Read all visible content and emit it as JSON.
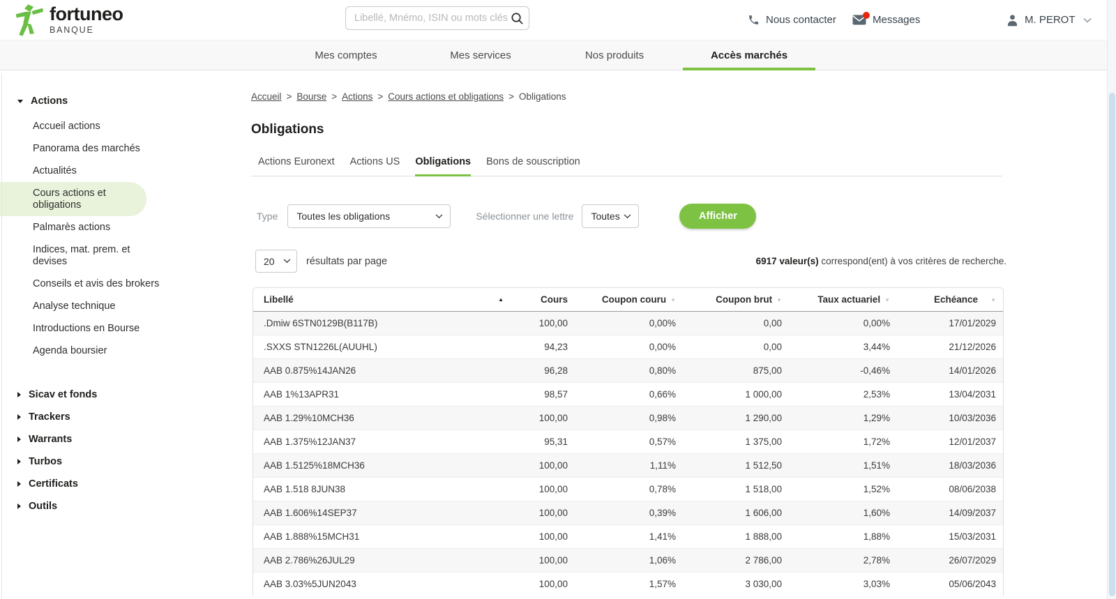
{
  "colors": {
    "accent_green": "#7dc242",
    "active_item_bg": "#e9f3dc",
    "notification_red": "#e8250c"
  },
  "icons": {
    "search": "magnifier-icon",
    "contact": "phone-icon",
    "messages": "envelope-icon",
    "messages_badge": "notification-dot",
    "user": "person-icon",
    "user_menu": "chevron-down-icon",
    "sort_active": "sort-asc-triangle",
    "sort_inactive": "sort-desc-triangle",
    "section_expanded": "triangle-down-icon",
    "section_collapsed": "triangle-right-icon"
  },
  "header": {
    "logo": {
      "brand": "fortuneo",
      "sub": "BANQUE"
    },
    "search": {
      "placeholder": "Libellé, Mnémo, ISIN ou mots clés"
    },
    "contact_label": "Nous contacter",
    "messages_label": "Messages",
    "user_name": "M. PEROT"
  },
  "nav": {
    "items": [
      {
        "label": "Mes comptes",
        "active": false
      },
      {
        "label": "Mes services",
        "active": false
      },
      {
        "label": "Nos produits",
        "active": false
      },
      {
        "label": "Accès marchés",
        "active": true
      }
    ]
  },
  "sidebar": {
    "sections": [
      {
        "label": "Actions",
        "expanded": true,
        "active_index": 3,
        "items": [
          "Accueil actions",
          "Panorama des marchés",
          "Actualités",
          "Cours actions et obligations",
          "Palmarès actions",
          "Indices, mat. prem. et devises",
          "Conseils et avis des brokers",
          "Analyse technique",
          "Introductions en Bourse",
          "Agenda boursier"
        ]
      },
      {
        "label": "Sicav et fonds",
        "expanded": false
      },
      {
        "label": "Trackers",
        "expanded": false
      },
      {
        "label": "Warrants",
        "expanded": false
      },
      {
        "label": "Turbos",
        "expanded": false
      },
      {
        "label": "Certificats",
        "expanded": false
      },
      {
        "label": "Outils",
        "expanded": false
      }
    ]
  },
  "breadcrumb": {
    "links": [
      "Accueil",
      "Bourse",
      "Actions",
      "Cours actions et obligations"
    ],
    "current": "Obligations",
    "separator": ">"
  },
  "page": {
    "title": "Obligations"
  },
  "tabs": {
    "items": [
      {
        "label": "Actions Euronext",
        "active": false
      },
      {
        "label": "Actions US",
        "active": false
      },
      {
        "label": "Obligations",
        "active": true
      },
      {
        "label": "Bons de souscription",
        "active": false
      }
    ]
  },
  "filters": {
    "type_label": "Type",
    "type_value": "Toutes les obligations",
    "letter_label": "Sélectionner une lettre",
    "letter_value": "Toutes",
    "submit_label": "Afficher"
  },
  "results": {
    "per_page_value": "20",
    "per_page_label": "résultats par page",
    "count_bold": "6917 valeur(s)",
    "count_rest": " correspond(ent) à vos critères de recherche."
  },
  "table": {
    "columns": [
      {
        "label": "Libellé",
        "sort": "asc"
      },
      {
        "label": "Cours",
        "sort": "none"
      },
      {
        "label": "Coupon couru",
        "sort": "inactive"
      },
      {
        "label": "Coupon brut",
        "sort": "inactive"
      },
      {
        "label": "Taux actuariel",
        "sort": "inactive"
      },
      {
        "label": "Echéance",
        "sort": "inactive"
      }
    ],
    "rows": [
      [
        ".Dmiw 6STN0129B(B117B)",
        "100,00",
        "0,00%",
        "0,00",
        "0,00%",
        "17/01/2029"
      ],
      [
        ".SXXS STN1226L(AUUHL)",
        "94,23",
        "0,00%",
        "0,00",
        "3,44%",
        "21/12/2026"
      ],
      [
        "AAB 0.875%14JAN26",
        "96,28",
        "0,80%",
        "875,00",
        "-0,46%",
        "14/01/2026"
      ],
      [
        "AAB 1%13APR31",
        "98,57",
        "0,66%",
        "1 000,00",
        "2,53%",
        "13/04/2031"
      ],
      [
        "AAB 1.29%10MCH36",
        "100,00",
        "0,98%",
        "1 290,00",
        "1,29%",
        "10/03/2036"
      ],
      [
        "AAB 1.375%12JAN37",
        "95,31",
        "0,57%",
        "1 375,00",
        "1,72%",
        "12/01/2037"
      ],
      [
        "AAB 1.5125%18MCH36",
        "100,00",
        "1,11%",
        "1 512,50",
        "1,51%",
        "18/03/2036"
      ],
      [
        "AAB 1.518 8JUN38",
        "100,00",
        "0,78%",
        "1 518,00",
        "1,52%",
        "08/06/2038"
      ],
      [
        "AAB 1.606%14SEP37",
        "100,00",
        "0,39%",
        "1 606,00",
        "1,60%",
        "14/09/2037"
      ],
      [
        "AAB 1.888%15MCH31",
        "100,00",
        "1,41%",
        "1 888,00",
        "1,88%",
        "15/03/2031"
      ],
      [
        "AAB 2.786%26JUL29",
        "100,00",
        "1,06%",
        "2 786,00",
        "2,78%",
        "26/07/2029"
      ],
      [
        "AAB 3.03%5JUN2043",
        "100,00",
        "1,57%",
        "3 030,00",
        "3,03%",
        "05/06/2043"
      ]
    ]
  }
}
